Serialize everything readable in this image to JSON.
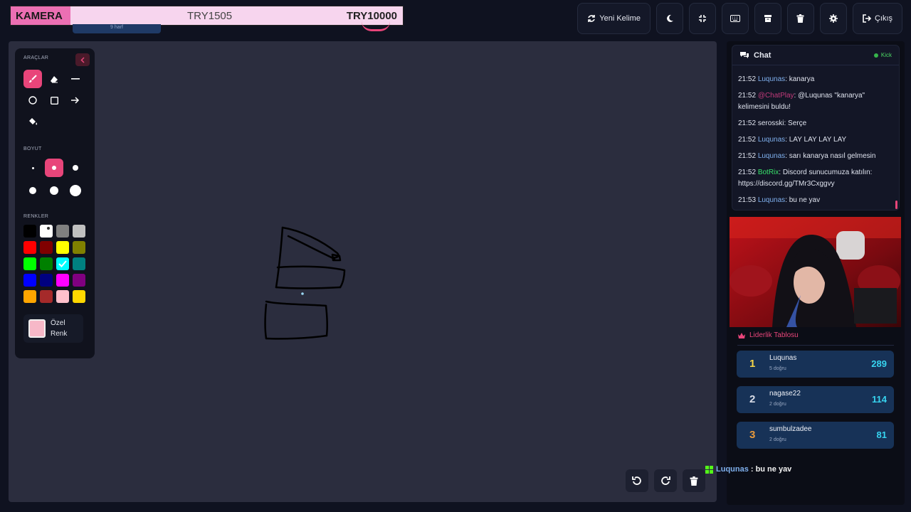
{
  "banner": {
    "left": "KAMERA",
    "middle": "TRY1505",
    "right": "TRY10000",
    "sub": "9 harf"
  },
  "topbar": {
    "new_word": "Yeni Kelime",
    "logout": "Çıkış"
  },
  "tools": {
    "title": "ARAÇLAR",
    "size_title": "BOYUT",
    "colors_title": "RENKLER",
    "custom_label_1": "Özel",
    "custom_label_2": "Renk",
    "custom_color": "#f7b8c8",
    "palette": [
      "#000000",
      "#ffffff",
      "#808080",
      "#c0c0c0",
      "#ff0000",
      "#800000",
      "#ffff00",
      "#808000",
      "#00ff00",
      "#008000",
      "#00ffff",
      "#008080",
      "#0000ff",
      "#000080",
      "#ff00ff",
      "#800080",
      "#ffa500",
      "#a52a2a",
      "#ffc0cb",
      "#ffd700"
    ]
  },
  "chat": {
    "title": "Chat",
    "platform": "Kick",
    "messages": [
      {
        "time": "21:52",
        "user": "Luqunas",
        "text": ": kanarya"
      },
      {
        "time": "21:52",
        "user": "@ChatPlay",
        "text": ": @Luqunas \"kanarya\" kelimesini buldu!"
      },
      {
        "time": "21:52",
        "user": "",
        "text": "serosski: Serçe"
      },
      {
        "time": "21:52",
        "user": "Luqunas",
        "text": ": LAY LAY LAY LAY"
      },
      {
        "time": "21:52",
        "user": "Luqunas",
        "text": ": sarı kanarya nasıl gelmesin"
      },
      {
        "time": "21:52",
        "user": "BotRix",
        "text": ": Discord sunucumuza katılın: https://discord.gg/TMr3Cxggvy"
      },
      {
        "time": "21:53",
        "user": "Luqunas",
        "text": ": bu ne yav"
      }
    ]
  },
  "leaderboard": {
    "title": "Liderlik Tablosu",
    "rows": [
      {
        "rank": "1",
        "name": "Luqunas",
        "sub": "5 doğru",
        "points": "289",
        "rank_color": "#f5d547"
      },
      {
        "rank": "2",
        "name": "nagase22",
        "sub": "2 doğru",
        "points": "114",
        "rank_color": "#d8dce6"
      },
      {
        "rank": "3",
        "name": "sumbulzadee",
        "sub": "2 doğru",
        "points": "81",
        "rank_color": "#e89a3c"
      }
    ]
  },
  "overlay": {
    "user": "Luqunas",
    "text": " : bu ne yav"
  },
  "accent": "#e8457a"
}
